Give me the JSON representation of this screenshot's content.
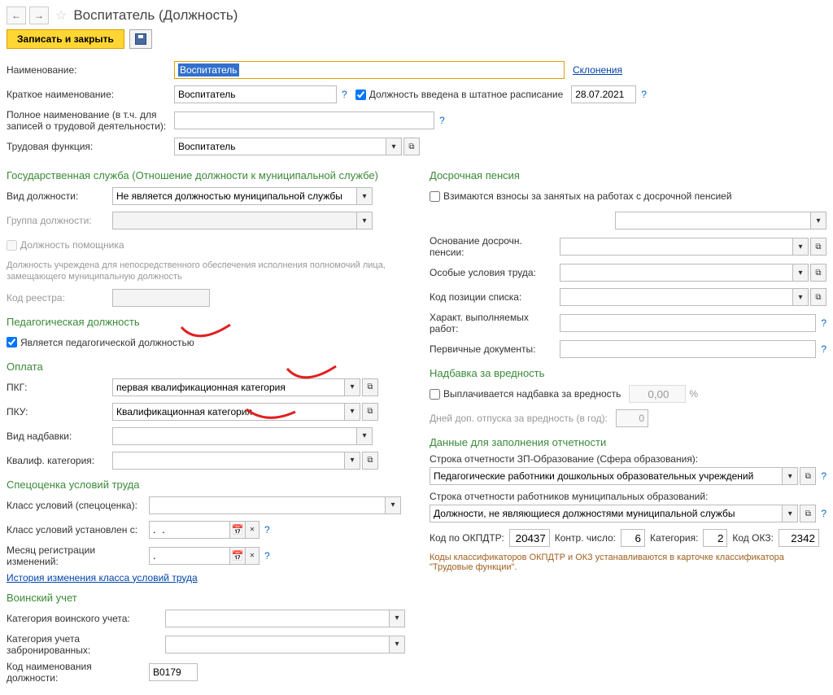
{
  "window": {
    "title": "Воспитатель (Должность)"
  },
  "actions": {
    "save_close": "Записать и закрыть"
  },
  "labels": {
    "name": "Наименование:",
    "short_name": "Краткое наименование:",
    "full_name1": "Полное наименование (в т.ч. для",
    "full_name2": "записей о трудовой деятельности):",
    "labor_func": "Трудовая функция:",
    "in_schedule": "Должность введена в штатное расписание",
    "declension": "Склонения"
  },
  "values": {
    "name": "Воспитатель",
    "short_name": "Воспитатель",
    "labor_func": "Воспитатель",
    "schedule_date": "28.07.2021"
  },
  "gov": {
    "title": "Государственная служба (Отношение должности к муниципальной службе)",
    "type_label": "Вид должности:",
    "type_value": "Не является должностью муниципальной службы",
    "group_label": "Группа должности:",
    "assistant": "Должность помощника",
    "help_text": "Должность учреждена для непосредственного обеспечения исполнения полномочий лица, замещающего муниципальную должность",
    "code_label": "Код реестра:"
  },
  "ped": {
    "title": "Педагогическая должность",
    "is_ped": "Является педагогической должностью"
  },
  "pay": {
    "title": "Оплата",
    "pkg_label": "ПКГ:",
    "pkg_value": "первая квалификационная категория",
    "pku_label": "ПКУ:",
    "pku_value": "Квалификационная категория",
    "bonus_label": "Вид надбавки:",
    "qual_label": "Квалиф. категория:"
  },
  "spec": {
    "title": "Спецоценка условий труда",
    "class_label": "Класс условий (спецоценка):",
    "class_date_label": "Класс условий установлен с:",
    "month_label": "Месяц регистрации изменений:",
    "date_placeholder": ".  .",
    "month_placeholder": ".",
    "history_link": "История изменения класса условий труда"
  },
  "mil": {
    "title": "Воинский учет",
    "cat_label": "Категория воинского учета:",
    "booked_label": "Категория учета забронированных:",
    "code_label": "Код наименования должности:",
    "code_value": "B0179"
  },
  "pension": {
    "title": "Досрочная пенсия",
    "fees": "Взимаются взносы за занятых на работах с досрочной пенсией",
    "basis_label": "Основание досрочн. пенсии:",
    "conditions_label": "Особые условия труда:",
    "list_code_label": "Код позиции списка:",
    "work_char_label": "Характ. выполняемых работ:",
    "docs_label": "Первичные документы:"
  },
  "hazard": {
    "title": "Надбавка за вредность",
    "paid": "Выплачивается надбавка за вредность",
    "value": "0,00",
    "percent": "%",
    "days_label": "Дней доп. отпуска за вредность (в год):",
    "days_value": "0"
  },
  "report": {
    "title": "Данные для заполнения отчетности",
    "line1_label": "Строка отчетности ЗП-Образование (Сфера образования):",
    "line1_value": "Педагогические работники дошкольных образовательных учреждений",
    "line2_label": "Строка отчетности работников муниципальных образований:",
    "line2_value": "Должности, не являющиеся должностями муниципальной службы",
    "okpdtr_label": "Код по ОКПДТР:",
    "okpdtr_value": "20437",
    "control_label": "Контр. число:",
    "control_value": "6",
    "cat_label": "Категория:",
    "cat_value": "2",
    "okz_label": "Код ОКЗ:",
    "okz_value": "2342",
    "footnote": "Коды классификаторов ОКПДТР и ОКЗ устанавливаются в карточке классификатора \"Трудовые функции\"."
  }
}
